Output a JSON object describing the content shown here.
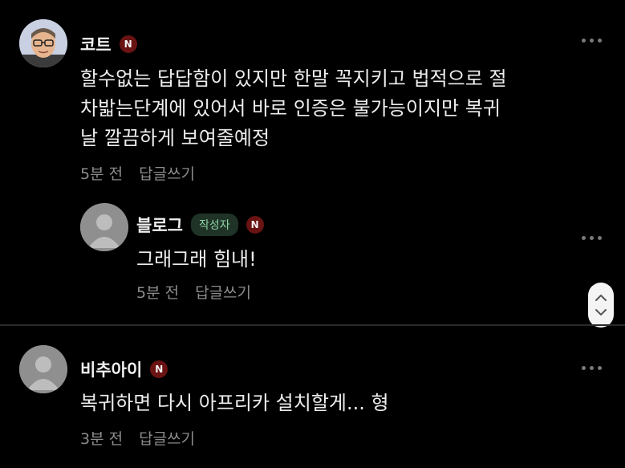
{
  "comments": [
    {
      "author": "코트",
      "badge": "N",
      "text": "할수없는 답답함이 있지만 한말 꼭지키고 법적으로 절\n차밟는단계에 있어서 바로 인증은 불가능이지만 복귀\n날 깔끔하게 보여줄예정",
      "time": "5분 전",
      "reply_label": "답글쓰기"
    },
    {
      "author": "블로그",
      "author_tag": "작성자",
      "badge": "N",
      "text": "그래그래 힘내!",
      "time": "5분 전",
      "reply_label": "답글쓰기"
    },
    {
      "author": "비추아이",
      "badge": "N",
      "text": "복귀하면 다시 아프리카 설치할게... 형",
      "time": "3분 전",
      "reply_label": "답글쓰기"
    }
  ],
  "icons": {
    "more": "more-dots-icon",
    "scroll_up": "chevron-up-icon",
    "scroll_down": "chevron-down-icon"
  },
  "colors": {
    "background": "#000000",
    "badge_red": "#6a1313",
    "author_tag_bg": "#1f3426",
    "author_tag_text": "#8fd1a6"
  }
}
